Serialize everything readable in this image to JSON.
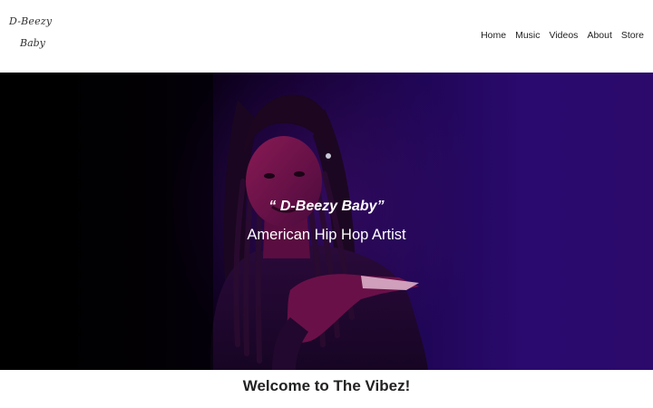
{
  "logo": {
    "line1": "D-Beezy",
    "line2": "Baby"
  },
  "nav": {
    "items": [
      "Home",
      "Music",
      "Videos",
      "About",
      "Store"
    ]
  },
  "hero": {
    "quote_open": "“ ",
    "quote_name": "D-Beezy Baby",
    "quote_close": "”",
    "subtitle": "American Hip Hop Artist",
    "background_image": "portrait-photo"
  },
  "welcome": {
    "prefix": "Welcome to ",
    "highlight": "The Vibez",
    "suffix": "!"
  },
  "colors": {
    "hero_dark": "#000000",
    "hero_purple": "#2a0a6e",
    "text_dark": "#222222"
  }
}
